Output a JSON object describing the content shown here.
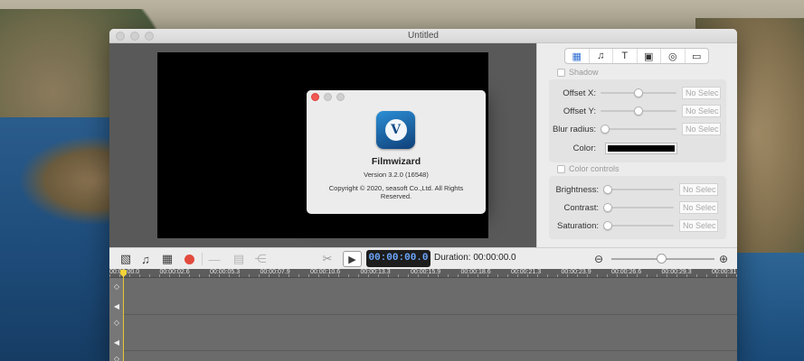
{
  "window": {
    "title": "Untitled"
  },
  "inspector": {
    "tabs": [
      {
        "name": "film-tab",
        "icon": "film-icon",
        "glyph": "▦",
        "active": true
      },
      {
        "name": "music-tab",
        "icon": "music-note-icon",
        "glyph": "♫",
        "active": false
      },
      {
        "name": "text-tab",
        "icon": "text-icon",
        "glyph": "T",
        "active": false
      },
      {
        "name": "filter-tab",
        "icon": "frames-icon",
        "glyph": "▣",
        "active": false
      },
      {
        "name": "shapes-tab",
        "icon": "shapes-icon",
        "glyph": "◎",
        "active": false
      },
      {
        "name": "folder-tab",
        "icon": "folder-icon",
        "glyph": "▭",
        "active": false
      }
    ],
    "shadow": {
      "label": "Shadow",
      "offset_x_label": "Offset X:",
      "offset_x_value": "No Selec",
      "offset_x_level": 0.5,
      "offset_y_label": "Offset Y:",
      "offset_y_value": "No Selec",
      "offset_y_level": 0.5,
      "blur_label": "Blur radius:",
      "blur_value": "No Selec",
      "blur_level": 0.0,
      "color_label": "Color:",
      "color_value": "#000000"
    },
    "color_controls": {
      "label": "Color controls",
      "brightness_label": "Brightness:",
      "brightness_value": "No Selec",
      "contrast_label": "Contrast:",
      "contrast_value": "No Selec",
      "saturation_label": "Saturation:",
      "saturation_value": "No Selec"
    }
  },
  "toolbar": {
    "icons": [
      "image-icon",
      "music-note-icon",
      "film-icon",
      "record-icon",
      "minus-icon",
      "grid-icon",
      "share-icon",
      "scissors-icon",
      "play-icon",
      "zoom-out-icon",
      "zoom-in-icon"
    ],
    "timecode": "00:00:00.0",
    "duration": "Duration: 00:00:00.0",
    "zoom_level": 0.45
  },
  "timeline": {
    "ruler_labels": [
      "00:00:00.0",
      "00:00:02.6",
      "00:00:05.3",
      "00:00:07.9",
      "00:00:10.6",
      "00:00:13.3",
      "00:00:15.9",
      "00:00:18.6",
      "00:00:21.3",
      "00:00:23.9",
      "00:00:26.6",
      "00:00:29.3",
      "00:00:31"
    ]
  },
  "about_dialog": {
    "app_name": "Filmwizard",
    "version": "Version 3.2.0 (16548)",
    "copyright": "Copyright © 2020, seasoft Co.,Ltd. All Rights Reserved.",
    "icon_letter": "V"
  }
}
